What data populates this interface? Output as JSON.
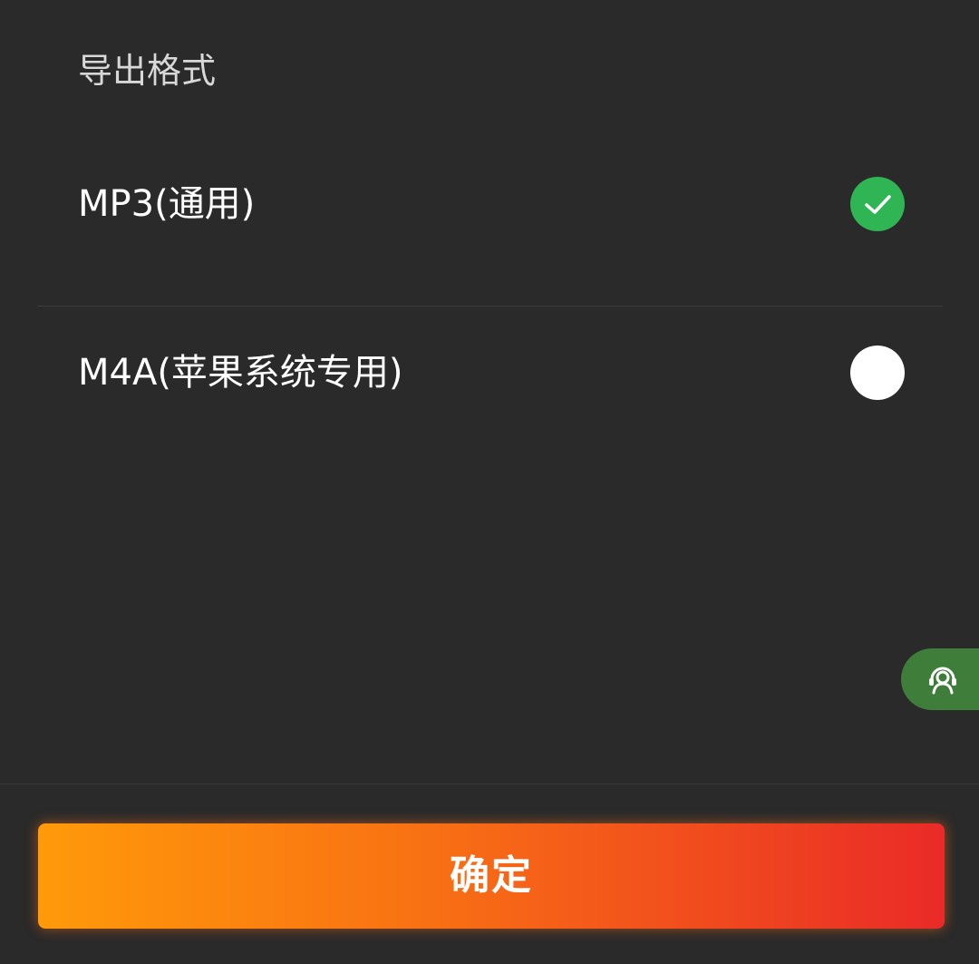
{
  "header": {
    "title": "导出格式"
  },
  "options": [
    {
      "label": "MP3(通用)",
      "selected": true
    },
    {
      "label": "M4A(苹果系统专用)",
      "selected": false
    }
  ],
  "floating_button": {
    "icon": "headset-support-icon"
  },
  "footer": {
    "confirm_label": "确定"
  },
  "colors": {
    "background": "#2a2a2a",
    "selected_radio": "#2fb553",
    "unselected_radio": "#ffffff",
    "floating_button": "#3f7d3a",
    "confirm_gradient_start": "#ff9a0a",
    "confirm_gradient_end": "#ea2a28"
  }
}
